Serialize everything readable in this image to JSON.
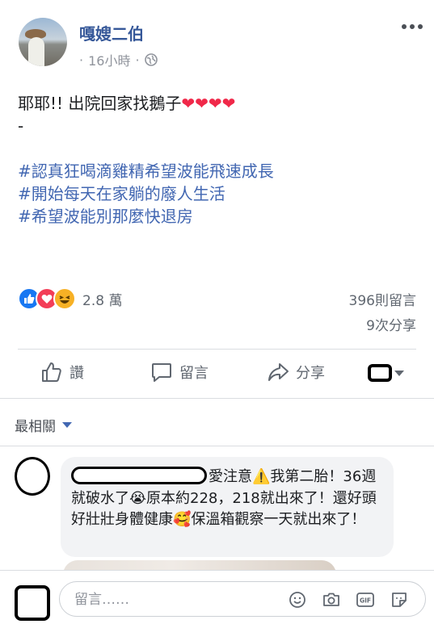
{
  "post": {
    "author": "嘎嫂二伯",
    "time": "16小時",
    "dot": "·",
    "text_line1": "耶耶!! 出院回家找鵝子",
    "hearts": "❤❤❤❤",
    "text_line2": "-",
    "hashtags": [
      "#認真狂喝滴雞精希望波能飛速成長",
      "#開始每天在家躺的廢人生活",
      "#希望波能別那麼快退房"
    ]
  },
  "reactions": {
    "count": "2.8 萬",
    "types": [
      "like",
      "love",
      "haha"
    ]
  },
  "stats": {
    "comments": "396則留言",
    "shares": "9次分享"
  },
  "actions": {
    "like": "讚",
    "comment": "留言",
    "share": "分享"
  },
  "sort": {
    "label": "最相關"
  },
  "comment": {
    "text": "愛注意⚠️我第二胎！36週就破水了😭原本約228，218就出來了！還好頭好壯壯身體健康🥰保溫箱觀察一天就出來了！"
  },
  "composer": {
    "placeholder": "留言……"
  },
  "colors": {
    "link": "#365899",
    "hashtag": "#4267b2",
    "love": "#f33e58",
    "like": "#1877f2"
  }
}
